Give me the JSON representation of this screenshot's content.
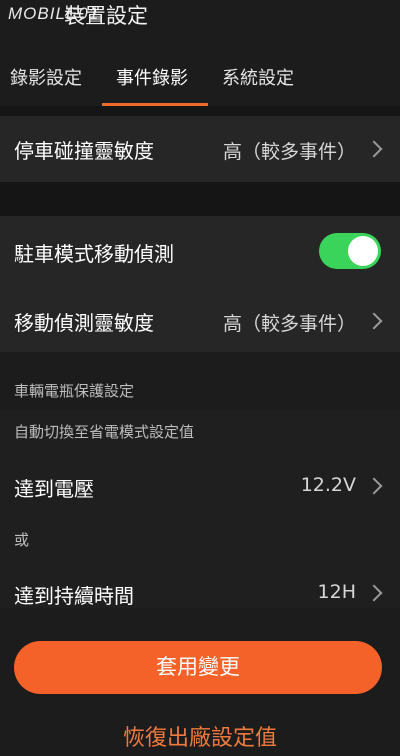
{
  "header": {
    "watermark": "MOBILE01",
    "title": "裝置設定"
  },
  "tabs": [
    {
      "label": "錄影設定",
      "active": false
    },
    {
      "label": "事件錄影",
      "active": true
    },
    {
      "label": "系統設定",
      "active": false
    }
  ],
  "parking_collision": {
    "label": "停車碰撞靈敏度",
    "value": "高（較多事件）"
  },
  "parking_motion": {
    "label": "駐車模式移動偵測",
    "enabled": true
  },
  "motion_sensitivity": {
    "label": "移動偵測靈敏度",
    "value": "高（較多事件）"
  },
  "battery": {
    "section_title": "車輛電瓶保護設定",
    "subtitle": "自動切換至省電模式設定值",
    "voltage": {
      "label": "達到電壓",
      "value": "12.2V"
    },
    "or_label": "或",
    "duration": {
      "label": "達到持續時間",
      "value": "12H"
    }
  },
  "actions": {
    "apply_label": "套用變更",
    "restore_label": "恢復出廠設定值"
  },
  "colors": {
    "accent": "#f4622a",
    "toggle_on": "#3bd45a",
    "background": "#1c1c1c"
  }
}
